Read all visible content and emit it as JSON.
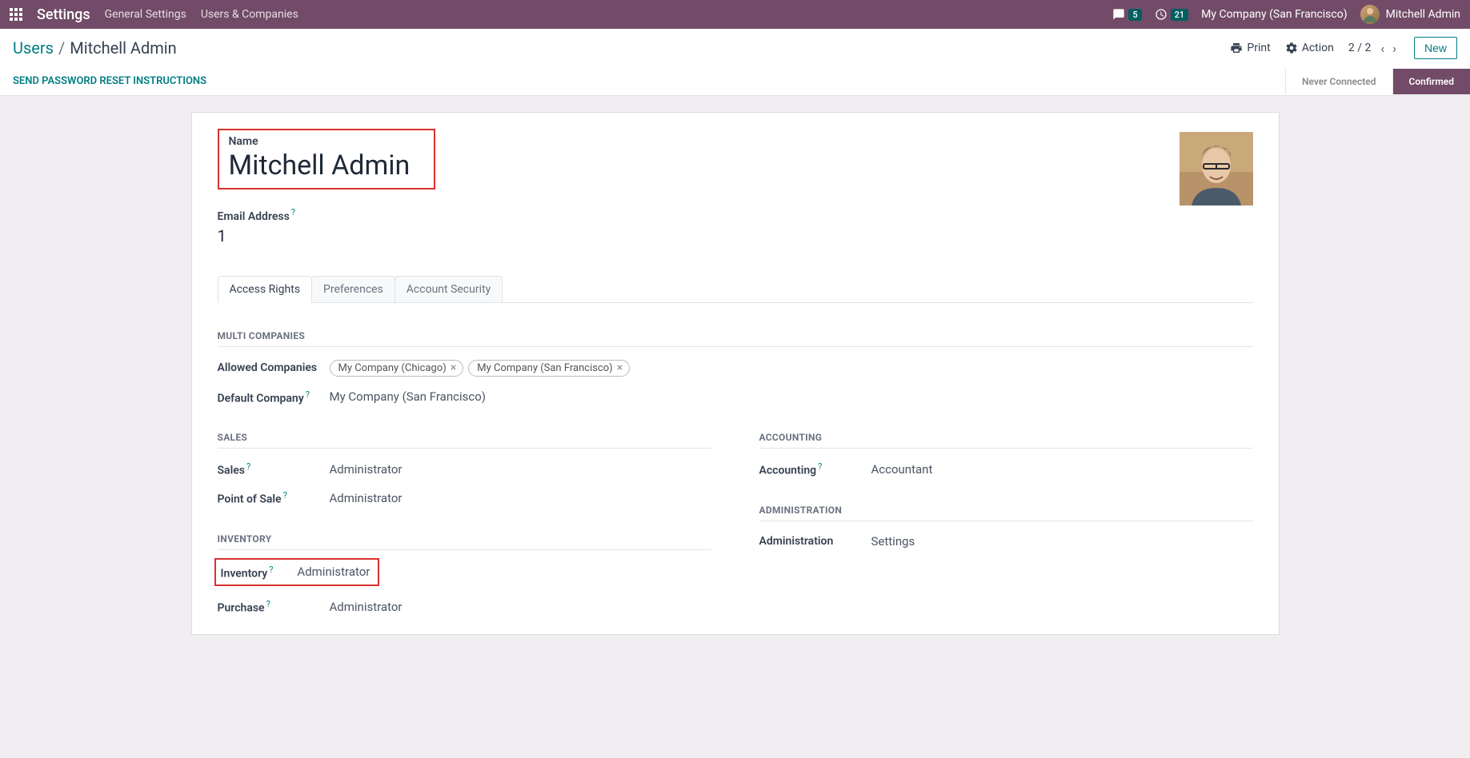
{
  "topbar": {
    "app_title": "Settings",
    "nav": {
      "general": "General Settings",
      "users": "Users & Companies"
    },
    "chat_count": "5",
    "activity_count": "21",
    "company": "My Company (San Francisco)",
    "user": "Mitchell Admin"
  },
  "breadcrumb": {
    "root": "Users",
    "current": "Mitchell Admin"
  },
  "actions": {
    "print": "Print",
    "action": "Action",
    "pager": "2 / 2",
    "new": "New"
  },
  "status_bar": {
    "send_reset": "Send Password Reset Instructions",
    "never_connected": "Never Connected",
    "confirmed": "Confirmed"
  },
  "form": {
    "name_label": "Name",
    "name_value": "Mitchell Admin",
    "email_label": "Email Address",
    "email_value": "1"
  },
  "tabs": {
    "access": "Access Rights",
    "prefs": "Preferences",
    "security": "Account Security"
  },
  "sections": {
    "multi_companies": "Multi Companies",
    "sales": "Sales",
    "accounting": "Accounting",
    "inventory": "Inventory",
    "administration": "Administration"
  },
  "fields": {
    "allowed_companies": "Allowed Companies",
    "default_company": "Default Company",
    "sales": "Sales",
    "pos": "Point of Sale",
    "accounting": "Accounting",
    "inventory": "Inventory",
    "purchase": "Purchase",
    "administration": "Administration"
  },
  "values": {
    "default_company": "My Company (San Francisco)",
    "sales": "Administrator",
    "pos": "Administrator",
    "accounting": "Accountant",
    "inventory": "Administrator",
    "purchase": "Administrator",
    "administration": "Settings"
  },
  "tags": {
    "company1": "My Company (Chicago)",
    "company2": "My Company (San Francisco)"
  }
}
